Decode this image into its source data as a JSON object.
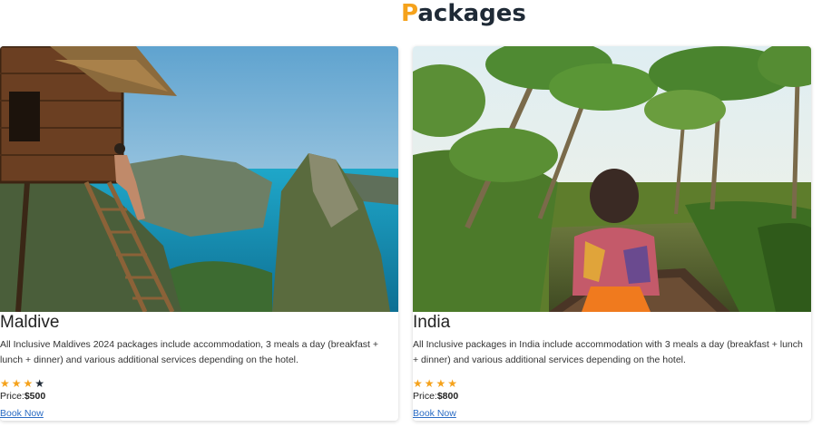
{
  "heading": {
    "first_letter": "P",
    "rest": "ackages"
  },
  "packages": [
    {
      "title": "Maldive",
      "description": "All Inclusive Maldives 2024 packages include accommodation, 3 meals a day (breakfast + lunch + dinner) and various additional services depending on the hotel.",
      "rating": 3,
      "rating_max": 4,
      "price_label": "Price:",
      "price_value": "$500",
      "link_label": "Book Now"
    },
    {
      "title": "India",
      "description": "All Inclusive packages in India include accommodation with 3 meals a day (breakfast + lunch + dinner) and various additional services depending on the hotel.",
      "rating": 4,
      "rating_max": 4,
      "price_label": "Price:",
      "price_value": "$800",
      "link_label": "Book Now"
    }
  ],
  "colors": {
    "accent": "#f5a21b",
    "dark": "#1f2a36",
    "link": "#2b6cc4"
  }
}
